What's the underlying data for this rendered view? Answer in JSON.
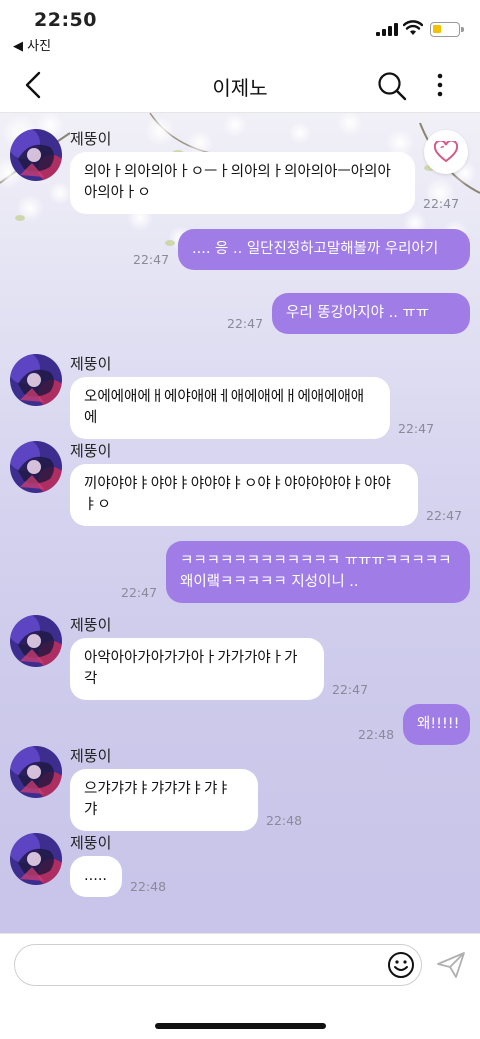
{
  "status": {
    "time": "22:50",
    "back_app": "◀ 사진"
  },
  "header": {
    "title": "이제노"
  },
  "colors": {
    "accent": "#a07ce6",
    "incoming_bubble": "#ffffff",
    "heart": "#d45a8a",
    "battery": "#f2c200"
  },
  "icons": {
    "back": "chevron-left-icon",
    "search": "search-icon",
    "more": "more-vertical-icon",
    "heart": "heart-icon",
    "emoji": "emoji-icon",
    "send": "send-icon"
  },
  "messages": [
    {
      "dir": "in",
      "sender": "제뚱이",
      "text": "의아ㅏ의아의아ㅏㅇㅡㅏ의아의ㅏ의아의아ㅡ아의아아의아ㅏㅇ",
      "time": "22:47"
    },
    {
      "dir": "out",
      "text": "....   응   .. 일단진정하고말해볼까 우리아기",
      "time": "22:47"
    },
    {
      "dir": "out",
      "text": "우리 똥강아지야   ..      ㅠㅠ",
      "time": "22:47"
    },
    {
      "dir": "in",
      "sender": "제뚱이",
      "text": "오에에애에ㅐ에야애애ㅔ애에애에ㅐ에애에애애에",
      "time": "22:47"
    },
    {
      "dir": "in",
      "sender": "제뚱이",
      "text": "끼야야야ㅑ야야ㅑ야야야ㅑㅇ야ㅑ야야야야야ㅑ야야ㅑㅇ",
      "time": "22:47"
    },
    {
      "dir": "out",
      "text": "ㅋㅋㅋㅋㅋㅋㅋㅋㅋㅋㅋㅋ ㅠㅠㅠㅋㅋㅋㅋㅋ 왜이랰ㅋㅋㅋㅋㅋ 지성이니   ..",
      "time": "22:47"
    },
    {
      "dir": "in",
      "sender": "제뚱이",
      "text": "아악아아가아가가아ㅏ가가가야ㅏ가각",
      "time": "22:47"
    },
    {
      "dir": "out",
      "text": "왜!!!!!",
      "time": "22:48"
    },
    {
      "dir": "in",
      "sender": "제뚱이",
      "text": "으갸갸갸ㅑ갸갸갸ㅑ갸ㅑ갸",
      "time": "22:48"
    },
    {
      "dir": "in",
      "sender": "제뚱이",
      "text": ".....",
      "time": "22:48"
    }
  ]
}
